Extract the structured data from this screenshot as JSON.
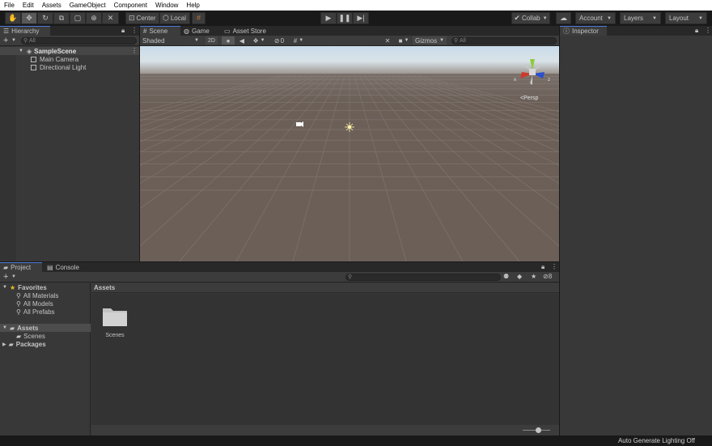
{
  "menu": [
    "File",
    "Edit",
    "Assets",
    "GameObject",
    "Component",
    "Window",
    "Help"
  ],
  "toolbar": {
    "pivot_label": "Center",
    "space_label": "Local",
    "collab_label": "Collab",
    "account_label": "Account",
    "layers_label": "Layers",
    "layout_label": "Layout"
  },
  "hierarchy": {
    "tab_label": "Hierarchy",
    "search_placeholder": "All",
    "scene_name": "SampleScene",
    "items": [
      "Main Camera",
      "Directional Light"
    ]
  },
  "scene_view": {
    "tabs": [
      "Scene",
      "Game",
      "Asset Store"
    ],
    "shading_mode": "Shaded",
    "mode_2d": "2D",
    "hidden_count": "0",
    "gizmos_label": "Gizmos",
    "search_placeholder": "All",
    "persp_label": "Persp",
    "gizmo_axes": [
      "y",
      "x",
      "z"
    ]
  },
  "inspector": {
    "tab_label": "Inspector"
  },
  "project": {
    "tabs": [
      "Project",
      "Console"
    ],
    "hidden_packages_count": "8",
    "favorites_label": "Favorites",
    "favorites": [
      "All Materials",
      "All Models",
      "All Prefabs"
    ],
    "assets_label": "Assets",
    "assets_children": [
      "Scenes"
    ],
    "packages_label": "Packages",
    "breadcrumb": "Assets",
    "grid_items": [
      "Scenes"
    ]
  },
  "status": {
    "lighting_text": "Auto Generate Lighting Off"
  },
  "colors": {
    "panel": "#383838",
    "dark": "#191919",
    "accent": "#4c7bd8",
    "scene_ground": "#6b5f58"
  }
}
